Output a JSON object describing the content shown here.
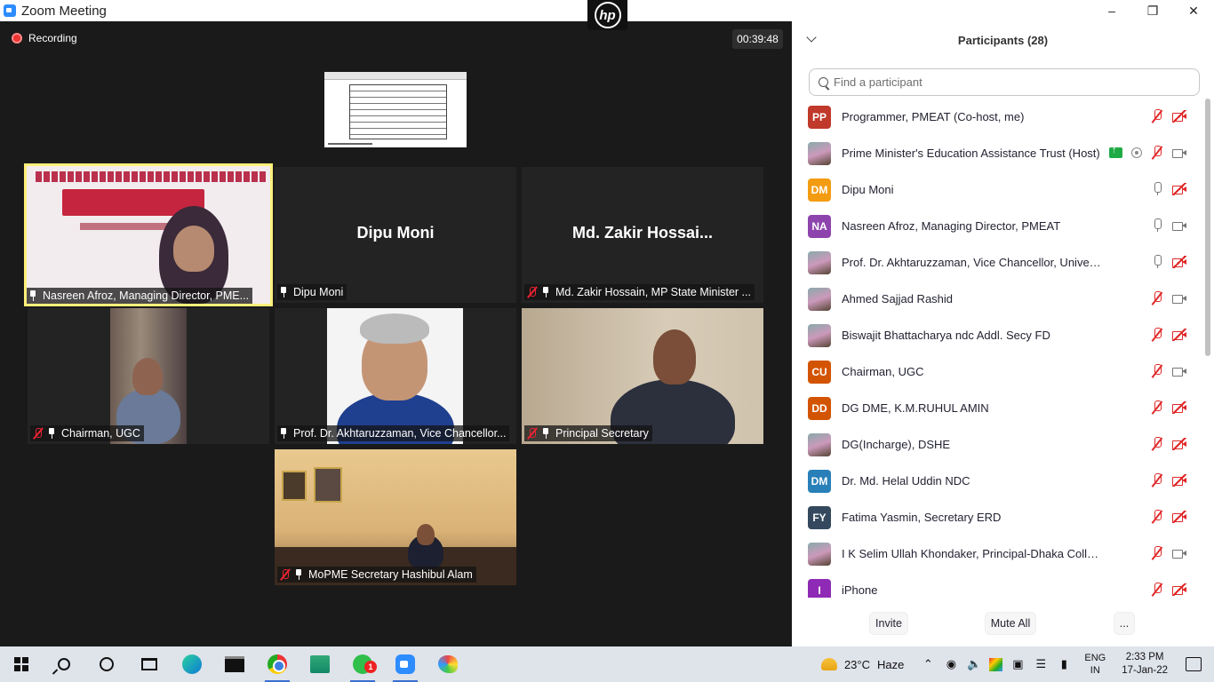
{
  "window": {
    "title": "Zoom Meeting",
    "hp_logo": "hp"
  },
  "meeting": {
    "recording_label": "Recording",
    "elapsed": "00:39:48"
  },
  "tiles": [
    {
      "name": "Nasreen Afroz, Managing Director, PME...",
      "muted": false,
      "pinned": true,
      "active": true,
      "video": "banner"
    },
    {
      "name": "Dipu Moni",
      "muted": false,
      "pinned": true,
      "active": false,
      "video": "none",
      "display_name": "Dipu Moni"
    },
    {
      "name": "Md. Zakir Hossain, MP State Minister ...",
      "muted": true,
      "pinned": true,
      "active": false,
      "video": "none",
      "display_name": "Md. Zakir Hossai..."
    },
    {
      "name": "Chairman, UGC",
      "muted": true,
      "pinned": true,
      "active": false,
      "video": "person"
    },
    {
      "name": "Prof. Dr. Akhtaruzzaman, Vice Chancellor...",
      "muted": false,
      "pinned": true,
      "active": false,
      "video": "portrait"
    },
    {
      "name": "Principal Secretary",
      "muted": true,
      "pinned": true,
      "active": false,
      "video": "person"
    },
    {
      "name": "MoPME Secretary Hashibul Alam",
      "muted": true,
      "pinned": true,
      "active": false,
      "video": "office"
    }
  ],
  "panel": {
    "title": "Participants (28)",
    "search_placeholder": "Find a participant",
    "participants": [
      {
        "initials": "PP",
        "color": "#c0392b",
        "name": "Programmer, PMEAT (Co-host, me)",
        "mic": "off",
        "cam": "off"
      },
      {
        "initials": "",
        "color": "#ffffff",
        "name": "Prime Minister's Education Assistance Trust (Host)",
        "mic": "off",
        "cam": "on",
        "sharing": true,
        "recording": true,
        "photo": true
      },
      {
        "initials": "DM",
        "color": "#f39c12",
        "name": "Dipu Moni",
        "mic": "on",
        "cam": "off"
      },
      {
        "initials": "NA",
        "color": "#8e44ad",
        "name": "Nasreen Afroz, Managing Director, PMEAT",
        "mic": "on",
        "cam": "on"
      },
      {
        "initials": "",
        "color": "#ffffff",
        "name": "Prof. Dr. Akhtaruzzaman, Vice Chancellor, University of Dh...",
        "mic": "on",
        "cam": "off",
        "photo": true
      },
      {
        "initials": "",
        "color": "#ffffff",
        "name": "Ahmed Sajjad Rashid",
        "mic": "off",
        "cam": "on",
        "photo": true
      },
      {
        "initials": "",
        "color": "#ffffff",
        "name": "Biswajit Bhattacharya ndc Addl. Secy FD",
        "mic": "off",
        "cam": "off",
        "photo": true
      },
      {
        "initials": "CU",
        "color": "#d35400",
        "name": "Chairman, UGC",
        "mic": "off",
        "cam": "on"
      },
      {
        "initials": "DD",
        "color": "#d35400",
        "name": "DG DME, K.M.RUHUL AMIN",
        "mic": "off",
        "cam": "off"
      },
      {
        "initials": "",
        "color": "#ffffff",
        "name": "DG(Incharge), DSHE",
        "mic": "off",
        "cam": "off",
        "photo": true
      },
      {
        "initials": "DM",
        "color": "#2980b9",
        "name": "Dr. Md. Helal Uddin NDC",
        "mic": "off",
        "cam": "off"
      },
      {
        "initials": "FY",
        "color": "#34495e",
        "name": "Fatima Yasmin, Secretary ERD",
        "mic": "off",
        "cam": "off"
      },
      {
        "initials": "",
        "color": "#ffffff",
        "name": "I K Selim Ullah Khondaker, Principal-Dhaka College",
        "mic": "off",
        "cam": "on",
        "photo": true
      },
      {
        "initials": "I",
        "color": "#8e2ab5",
        "name": "iPhone",
        "mic": "off",
        "cam": "off"
      }
    ],
    "footer": {
      "invite": "Invite",
      "mute_all": "Mute All",
      "more": "..."
    }
  },
  "taskbar": {
    "weather_temp": "23°C",
    "weather_desc": "Haze",
    "lang_top": "ENG",
    "lang_bottom": "IN",
    "time": "2:33 PM",
    "date": "17-Jan-22",
    "whatsapp_badge": "1"
  }
}
